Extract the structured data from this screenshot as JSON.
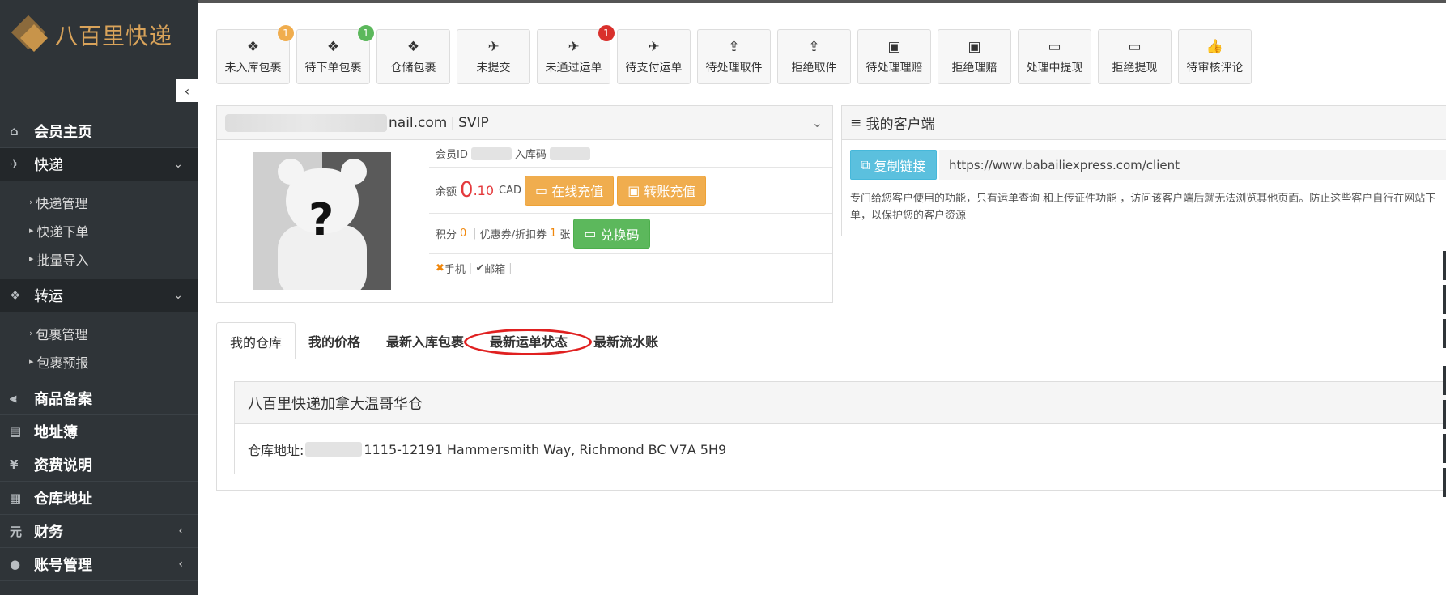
{
  "brand": {
    "logo_text": "八百里快递"
  },
  "sidebar": {
    "items": [
      {
        "label": "会员主页",
        "icon": "home-icon"
      },
      {
        "label": "快递",
        "icon": "plane-icon",
        "expanded": true,
        "children": [
          "快递管理",
          "快递下单",
          "批量导入"
        ]
      },
      {
        "label": "转运",
        "icon": "dropbox-icon",
        "expanded": true,
        "children": [
          "包裹管理",
          "包裹预报"
        ]
      },
      {
        "label": "商品备案",
        "icon": "cutlery-icon"
      },
      {
        "label": "地址簿",
        "icon": "addressbook-icon"
      },
      {
        "label": "资费说明",
        "icon": "yen-icon"
      },
      {
        "label": "仓库地址",
        "icon": "archive-icon"
      },
      {
        "label": "财务",
        "icon": "yuan-icon"
      },
      {
        "label": "账号管理",
        "icon": "user-icon"
      }
    ]
  },
  "quick_actions": [
    {
      "label": "未入库包裹",
      "icon": "dropbox-icon",
      "badge": "1",
      "badge_color": "#f0ad4e"
    },
    {
      "label": "待下单包裹",
      "icon": "dropbox-icon",
      "badge": "1",
      "badge_color": "#5cb85c"
    },
    {
      "label": "仓储包裹",
      "icon": "dropbox-icon"
    },
    {
      "label": "未提交",
      "icon": "plane-icon"
    },
    {
      "label": "未通过运单",
      "icon": "plane-icon",
      "badge": "1",
      "badge_color": "#d9302c"
    },
    {
      "label": "待支付运单",
      "icon": "plane-icon"
    },
    {
      "label": "待处理取件",
      "icon": "upload-icon"
    },
    {
      "label": "拒绝取件",
      "icon": "upload-icon"
    },
    {
      "label": "待处理理赔",
      "icon": "money-icon"
    },
    {
      "label": "拒绝理赔",
      "icon": "money-icon"
    },
    {
      "label": "处理中提现",
      "icon": "credit-card-icon"
    },
    {
      "label": "拒绝提现",
      "icon": "credit-card-icon"
    },
    {
      "label": "待审核评论",
      "icon": "thumbs-up-icon"
    }
  ],
  "user": {
    "email_suffix": "nail.com",
    "level": "SVIP",
    "member_id_label": "会员ID",
    "storage_code_label": "入库码",
    "balance_label": "余额",
    "balance_int": "0",
    "balance_dec": ".10",
    "currency": "CAD",
    "recharge_online": "在线充值",
    "recharge_transfer": "转账充值",
    "points_label": "积分",
    "points": "0",
    "coupon_label": "优惠券/折扣券",
    "coupon_count": "1",
    "coupon_unit": "张",
    "redeem": "兑换码",
    "phone_label": "手机",
    "email_label": "邮箱"
  },
  "client": {
    "title": "我的客户端",
    "copy_btn": "复制链接",
    "url": "https://www.babailiexpress.com/client",
    "desc": "专门给您客户使用的功能，只有运单查询 和上传证件功能 ，访问该客户端后就无法浏览其他页面。防止这些客户自行在网站下单，以保护您的客户资源"
  },
  "tabs": [
    "我的仓库",
    "我的价格",
    "最新入库包裹",
    "最新运单状态",
    "最新流水账"
  ],
  "warehouse": {
    "name": "八百里快递加拿大温哥华仓",
    "address_label": "仓库地址:",
    "address": "1115-12191 Hammersmith Way, Richmond BC V7A 5H9"
  }
}
